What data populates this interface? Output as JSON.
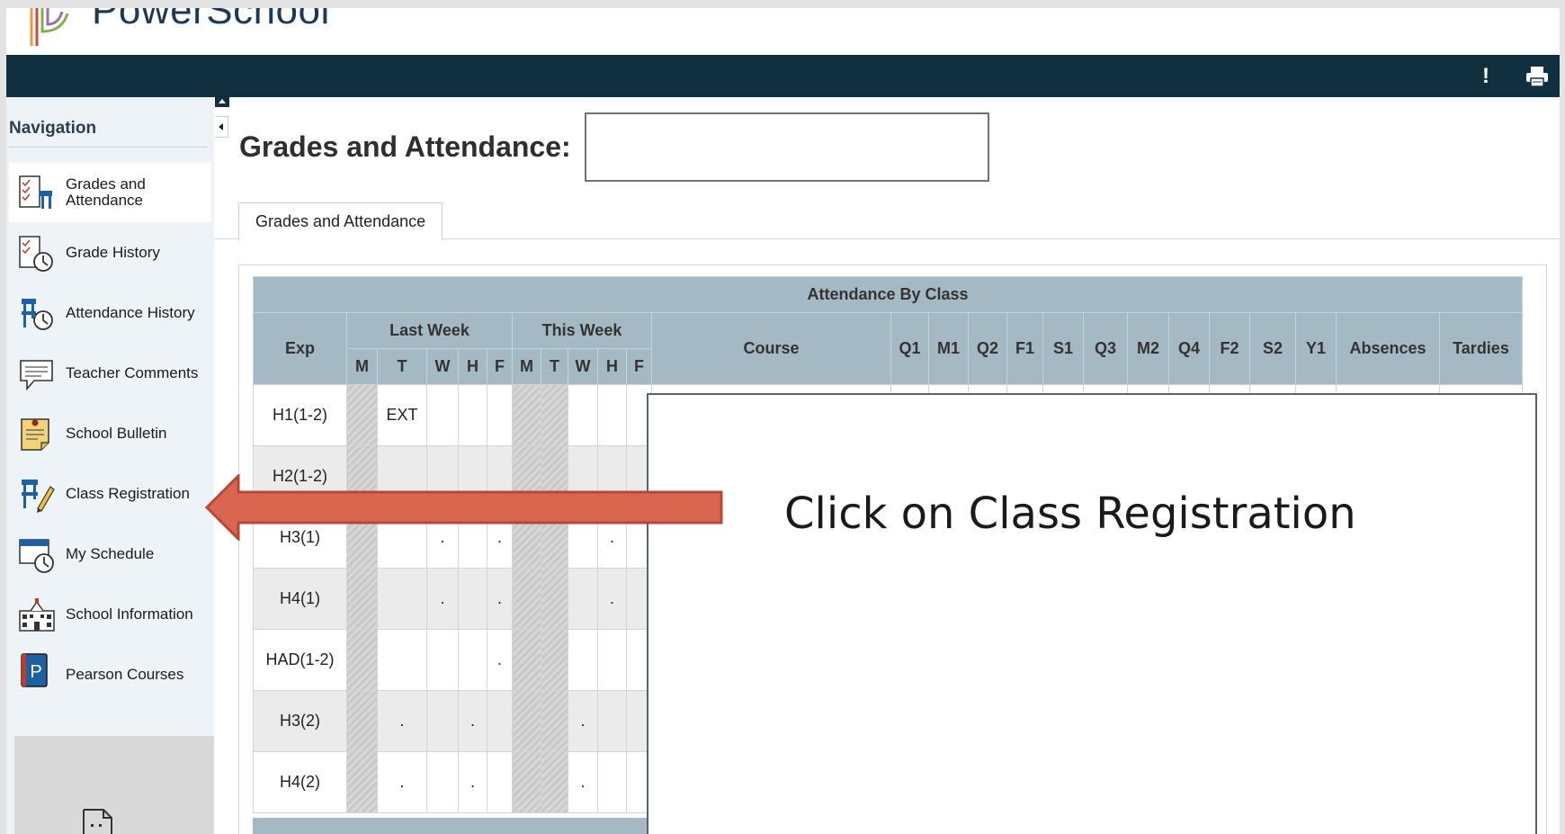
{
  "app": {
    "logo_text": "PowerSchool"
  },
  "header": {
    "alert_icon": "alert-icon",
    "print_icon": "printer-icon"
  },
  "sidebar": {
    "title": "Navigation",
    "items": [
      {
        "label": "Grades and Attendance",
        "icon": "grades-attendance-icon",
        "active": true
      },
      {
        "label": "Grade History",
        "icon": "grade-history-icon"
      },
      {
        "label": "Attendance History",
        "icon": "attendance-history-icon"
      },
      {
        "label": "Teacher Comments",
        "icon": "teacher-comments-icon"
      },
      {
        "label": "School Bulletin",
        "icon": "school-bulletin-icon"
      },
      {
        "label": "Class Registration",
        "icon": "class-registration-icon"
      },
      {
        "label": "My Schedule",
        "icon": "my-schedule-icon"
      },
      {
        "label": "School Information",
        "icon": "school-information-icon"
      },
      {
        "label": "Pearson Courses",
        "icon": "pearson-courses-icon"
      }
    ]
  },
  "main": {
    "title": "Grades and Attendance:",
    "tab_label": "Grades and Attendance"
  },
  "table": {
    "caption": "Attendance By Class",
    "headers": {
      "exp": "Exp",
      "last_week": "Last Week",
      "this_week": "This Week",
      "course": "Course",
      "terms": [
        "Q1",
        "M1",
        "Q2",
        "F1",
        "S1",
        "Q3",
        "M2",
        "Q4",
        "F2",
        "S2",
        "Y1"
      ],
      "absences": "Absences",
      "tardies": "Tardies",
      "days": [
        "M",
        "T",
        "W",
        "H",
        "F",
        "M",
        "T",
        "W",
        "H",
        "F"
      ]
    },
    "rows": [
      {
        "exp": "H1(1-2)",
        "days": [
          "",
          "EXT",
          "",
          "",
          "",
          "",
          "",
          "",
          "",
          ""
        ]
      },
      {
        "exp": "H2(1-2)",
        "days": [
          "",
          "",
          "",
          "",
          "",
          "",
          "",
          "",
          "",
          ""
        ]
      },
      {
        "exp": "H3(1)",
        "days": [
          "",
          "",
          ".",
          "",
          ".",
          "",
          "",
          "",
          ".",
          ""
        ]
      },
      {
        "exp": "H4(1)",
        "days": [
          "",
          "",
          ".",
          "",
          ".",
          "",
          "",
          "",
          ".",
          ""
        ]
      },
      {
        "exp": "HAD(1-2)",
        "days": [
          "",
          "",
          "",
          "",
          ".",
          "",
          "",
          "",
          "",
          ""
        ]
      },
      {
        "exp": "H3(2)",
        "days": [
          "",
          ".",
          "",
          ".",
          "",
          "",
          "",
          ".",
          "",
          ""
        ]
      },
      {
        "exp": "H4(2)",
        "days": [
          "",
          ".",
          "",
          ".",
          "",
          "",
          "",
          ".",
          "",
          ""
        ]
      }
    ]
  },
  "callout": {
    "text": "Click on Class Registration"
  },
  "colors": {
    "topbar": "#10303f",
    "table_header": "#a4b9c4",
    "arrow": "#d9674f",
    "arrow_border": "#c0504d"
  }
}
